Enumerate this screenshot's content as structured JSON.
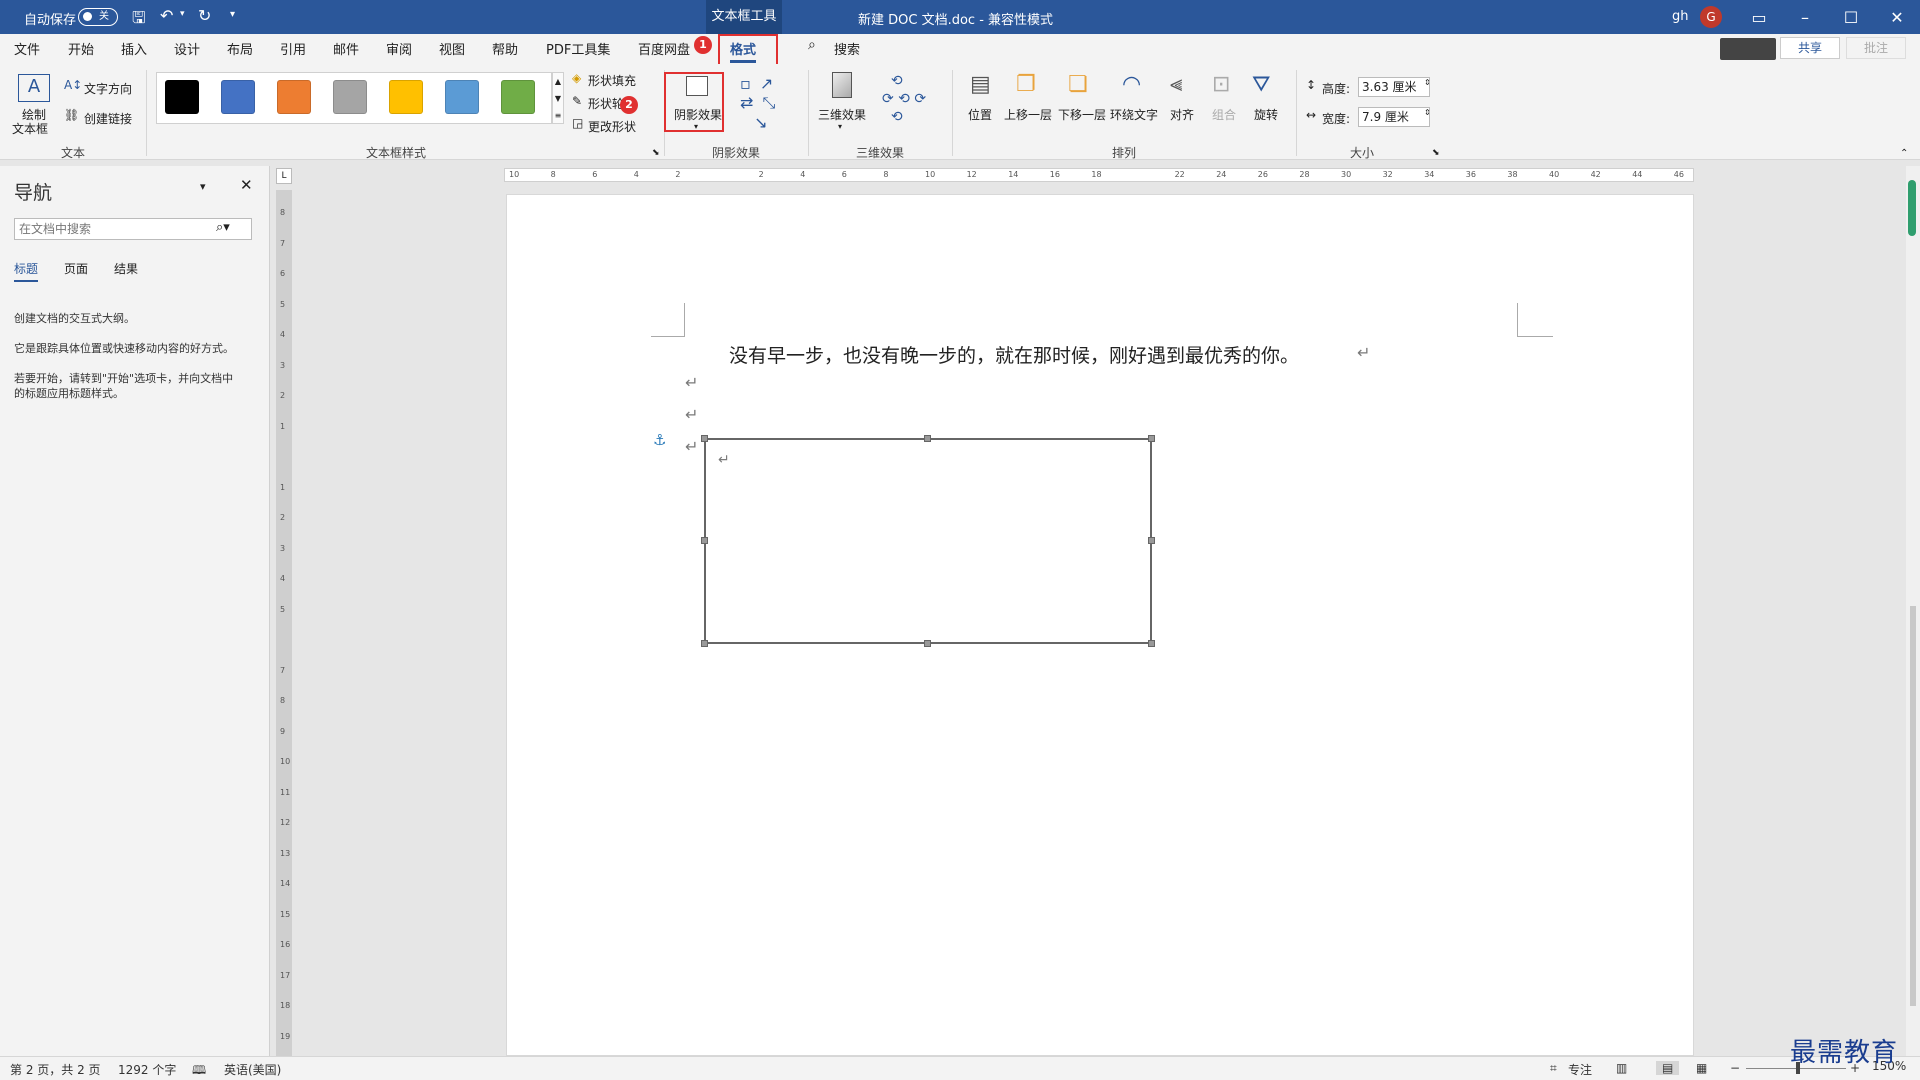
{
  "titlebar": {
    "autosave_label": "自动保存",
    "autosave_state": "关",
    "context_tab": "文本框工具",
    "doc_title": "新建 DOC 文档.doc  -  兼容性模式",
    "user_initials": "gh",
    "avatar_letter": "G"
  },
  "menu": {
    "tabs": [
      "文件",
      "开始",
      "插入",
      "设计",
      "布局",
      "引用",
      "邮件",
      "审阅",
      "视图",
      "帮助",
      "PDF工具集",
      "百度网盘",
      "格式"
    ],
    "active_tab": "格式",
    "search_label": "搜索",
    "share_label": "共享",
    "comment_label": "批注"
  },
  "badges": {
    "one": "1",
    "two": "2"
  },
  "ribbon": {
    "text_group": {
      "label": "文本",
      "draw_textbox": "绘制",
      "draw_textbox2": "文本框",
      "text_direction": "文字方向",
      "create_link": "创建链接"
    },
    "style_group": {
      "label": "文本框样式",
      "shape_fill": "形状填充",
      "shape_outline": "形状轮",
      "change_shape": "更改形状",
      "swatches": [
        "#000000",
        "#4472c4",
        "#ed7d31",
        "#a5a5a5",
        "#ffc000",
        "#5b9bd5",
        "#70ad47"
      ]
    },
    "shadow_group": {
      "label": "阴影效果",
      "button": "阴影效果"
    },
    "threed_group": {
      "label": "三维效果",
      "button": "三维效果"
    },
    "arrange_group": {
      "label": "排列",
      "position": "位置",
      "bring_forward": "上移一层",
      "send_backward": "下移一层",
      "wrap_text": "环绕文字",
      "align": "对齐",
      "group": "组合",
      "rotate": "旋转"
    },
    "size_group": {
      "label": "大小",
      "height_label": "高度:",
      "height_value": "3.63 厘米",
      "width_label": "宽度:",
      "width_value": "7.9 厘米"
    }
  },
  "nav": {
    "title": "导航",
    "search_placeholder": "在文档中搜索",
    "tabs": [
      "标题",
      "页面",
      "结果"
    ],
    "line1": "创建文档的交互式大纲。",
    "line2": "它是跟踪具体位置或快速移动内容的好方式。",
    "line3a": "若要开始，请转到\"开始\"选项卡，并向文档中",
    "line3b": "的标题应用标题样式。"
  },
  "ruler": {
    "h_ticks": [
      "10",
      "8",
      "6",
      "4",
      "2",
      "",
      "2",
      "4",
      "6",
      "8",
      "10",
      "12",
      "14",
      "16",
      "18",
      "",
      "22",
      "24",
      "26",
      "28",
      "30",
      "32",
      "34",
      "36",
      "38",
      "40",
      "42",
      "44",
      "46"
    ],
    "v_ticks": [
      "8",
      "7",
      "6",
      "5",
      "4",
      "3",
      "2",
      "1",
      "",
      "1",
      "2",
      "3",
      "4",
      "5",
      "",
      "7",
      "8",
      "9",
      "10",
      "11",
      "12",
      "13",
      "14",
      "15",
      "16",
      "17",
      "18",
      "19"
    ]
  },
  "document": {
    "line1": "没有早一步，也没有晚一步的，就在那时候，刚好遇到最优秀的你。",
    "para_mark": "↵",
    "anchor": "⚓"
  },
  "status": {
    "page": "第 2 页，共 2 页",
    "words": "1292 个字",
    "language": "英语(美国)",
    "focus": "专注",
    "zoom": "150%"
  },
  "watermark": "最需教育"
}
